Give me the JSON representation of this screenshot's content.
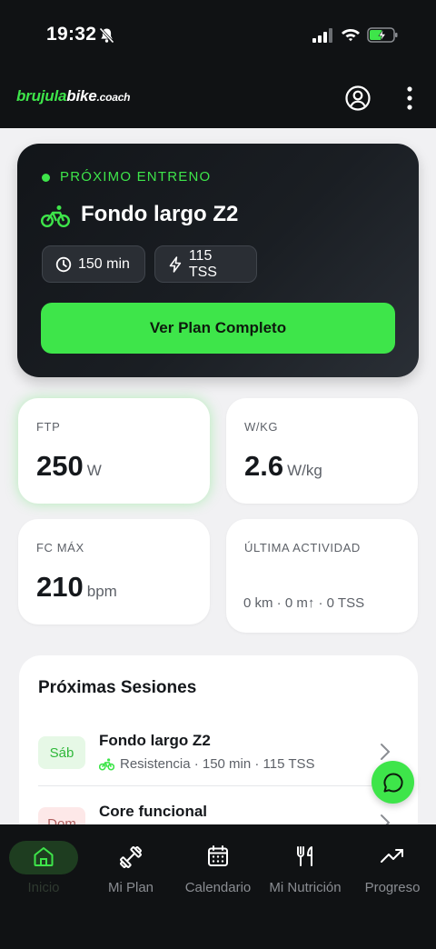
{
  "status_bar": {
    "time": "19:32"
  },
  "header": {
    "logo_part1": "brujula",
    "logo_part2": "bike",
    "logo_part3": ".coach"
  },
  "next_training": {
    "label": "PRÓXIMO ENTRENO",
    "title": "Fondo largo Z2",
    "duration": "150 min",
    "tss": "115 TSS",
    "cta": "Ver Plan Completo"
  },
  "metrics": {
    "ftp": {
      "label": "FTP",
      "value": "250",
      "unit": "W"
    },
    "wkg": {
      "label": "W/KG",
      "value": "2.6",
      "unit": "W/kg"
    },
    "fc_max": {
      "label": "FC MÁX",
      "value": "210",
      "unit": "bpm"
    },
    "last_activity": {
      "label": "ÚLTIMA ACTIVIDAD",
      "value": "0 km · 0 m↑ · 0 TSS"
    }
  },
  "sessions": {
    "title": "Próximas Sesiones",
    "items": [
      {
        "day": "Sáb",
        "name": "Fondo largo Z2",
        "meta": "Resistencia · 150 min · 115 TSS"
      },
      {
        "day": "Dom",
        "name": "Core funcional"
      }
    ]
  },
  "nav": {
    "items": [
      {
        "label": "Inicio"
      },
      {
        "label": "Mi Plan"
      },
      {
        "label": "Calendario"
      },
      {
        "label": "Mi Nutrición"
      },
      {
        "label": "Progreso"
      }
    ]
  },
  "colors": {
    "accent": "#3ee54a",
    "dark": "#101214",
    "background": "#f1f1f3"
  }
}
